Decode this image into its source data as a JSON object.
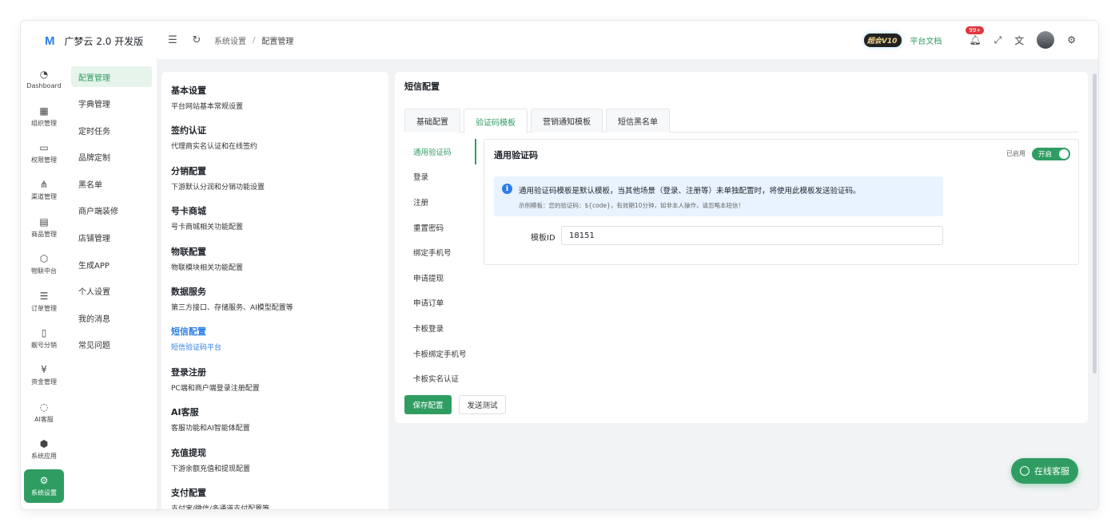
{
  "app": {
    "logo_mark": "M",
    "name": "广梦云 2.0 开发版"
  },
  "topbar": {
    "breadcrumb_parent": "系统设置",
    "breadcrumb_sep": "/",
    "breadcrumb_current": "配置管理",
    "vip_label": "超会V10",
    "doc_link": "平台文档",
    "notify_badge": "99+"
  },
  "iconbar": [
    {
      "icon": "dashboard-icon",
      "glyph": "◔",
      "label": "Dashboard"
    },
    {
      "icon": "org-icon",
      "glyph": "▦",
      "label": "组织管理"
    },
    {
      "icon": "monitor-icon",
      "glyph": "▭",
      "label": "权限管理"
    },
    {
      "icon": "channel-icon",
      "glyph": "⋔",
      "label": "渠道管理"
    },
    {
      "icon": "store-icon",
      "glyph": "▤",
      "label": "商品管理"
    },
    {
      "icon": "iot-icon",
      "glyph": "⬡",
      "label": "物联中台"
    },
    {
      "icon": "list-icon",
      "glyph": "☰",
      "label": "订单管理"
    },
    {
      "icon": "phone-icon",
      "glyph": "▯",
      "label": "靓号分销"
    },
    {
      "icon": "money-icon",
      "glyph": "¥",
      "label": "资金管理"
    },
    {
      "icon": "ai-icon",
      "glyph": "◌",
      "label": "AI客服"
    },
    {
      "icon": "cube-icon",
      "glyph": "⬢",
      "label": "系统应用"
    },
    {
      "icon": "gear-icon",
      "glyph": "⚙",
      "label": "系统设置"
    }
  ],
  "submenu": [
    "配置管理",
    "字典管理",
    "定时任务",
    "品牌定制",
    "黑名单",
    "商户端装修",
    "店铺管理",
    "生成APP",
    "个人设置",
    "我的消息",
    "常见问题"
  ],
  "config_list": [
    {
      "title": "基本设置",
      "desc": "平台网站基本常规设置"
    },
    {
      "title": "签约认证",
      "desc": "代理商实名认证和在线签约"
    },
    {
      "title": "分销配置",
      "desc": "下游默认分润和分销功能设置"
    },
    {
      "title": "号卡商城",
      "desc": "号卡商城相关功能配置"
    },
    {
      "title": "物联配置",
      "desc": "物联模块相关功能配置"
    },
    {
      "title": "数据服务",
      "desc": "第三方接口、存储服务、AI模型配置等"
    },
    {
      "title": "短信配置",
      "desc": "短信验证码平台"
    },
    {
      "title": "登录注册",
      "desc": "PC端和商户端登录注册配置"
    },
    {
      "title": "AI客服",
      "desc": "客服功能和AI智能体配置"
    },
    {
      "title": "充值提现",
      "desc": "下游余额充值和提现配置"
    },
    {
      "title": "支付配置",
      "desc": "支付宝/微信/多通道支付配置等"
    }
  ],
  "main": {
    "title": "短信配置",
    "tabs": [
      "基础配置",
      "验证码模板",
      "营销通知模板",
      "短信黑名单"
    ],
    "scenes": [
      "通用验证码",
      "登录",
      "注册",
      "重置密码",
      "绑定手机号",
      "申请提现",
      "申请订单",
      "卡板登录",
      "卡板绑定手机号",
      "卡板实名认证"
    ],
    "detail": {
      "title": "通用验证码",
      "enabled_label": "已启用",
      "switch_label": "开启",
      "info_main": "通用验证码模板是默认模板，当其他场景（登录、注册等）未单独配置时，将使用此模板发送验证码。",
      "info_sub": "示例模板：您的验证码：${code}，有效期10分钟，如非本人操作，请忽略本短信！",
      "field_label": "模板ID",
      "field_value": "18151"
    },
    "save_label": "保存配置",
    "test_label": "发送测试"
  },
  "support_label": "在线客服",
  "colors": {
    "accent": "#2f9d62",
    "link": "#2b7de9",
    "info_bg": "#e8f3ff"
  }
}
